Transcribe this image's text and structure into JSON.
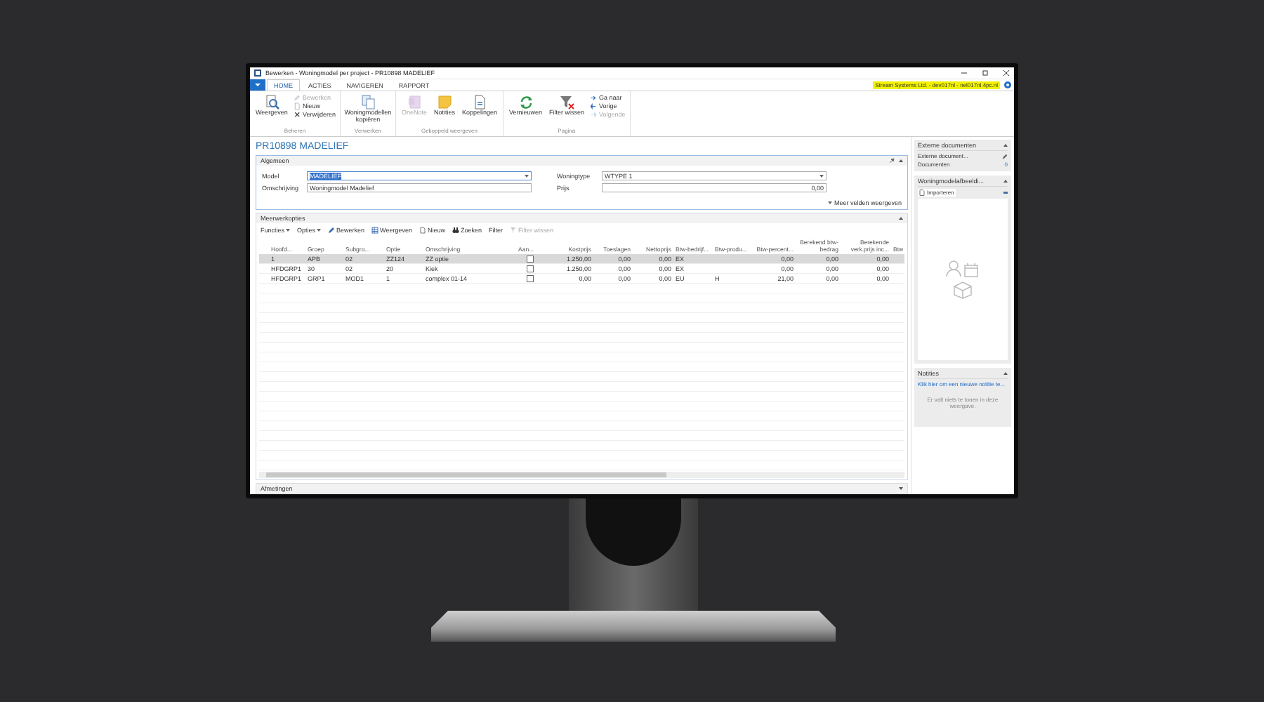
{
  "window": {
    "title": "Bewerken - Woningmodel per project - PR10898 MADELIEF"
  },
  "tabs": [
    {
      "label": "HOME",
      "selected": true
    },
    {
      "label": "ACTIES",
      "selected": false
    },
    {
      "label": "NAVIGEREN",
      "selected": false
    },
    {
      "label": "RAPPORT",
      "selected": false
    }
  ],
  "company": "Stream Systems Ltd. - dev017nl - nel017nl.4pc.nl",
  "ribbon": [
    {
      "label": "Beheren",
      "items": [
        {
          "label": "Weergeven",
          "kind": "large",
          "disabled": false
        },
        {
          "label": "Bewerken",
          "kind": "small",
          "disabled": true
        },
        {
          "label": "Nieuw",
          "kind": "small",
          "disabled": false
        },
        {
          "label": "Verwijderen",
          "kind": "small",
          "disabled": false
        }
      ]
    },
    {
      "label": "Verwerken",
      "items": [
        {
          "label": "Woningmodellen kopiëren",
          "kind": "large",
          "disabled": false
        }
      ]
    },
    {
      "label": "Gekoppeld weergeven",
      "items": [
        {
          "label": "OneNote",
          "kind": "large",
          "disabled": true
        },
        {
          "label": "Notities",
          "kind": "large",
          "disabled": false
        },
        {
          "label": "Koppelingen",
          "kind": "large",
          "disabled": false
        }
      ]
    },
    {
      "label": "Pagina",
      "items": [
        {
          "label": "Vernieuwen",
          "kind": "large",
          "disabled": false
        },
        {
          "label": "Filter wissen",
          "kind": "large",
          "disabled": false
        },
        {
          "label": "Ga naar",
          "kind": "small",
          "disabled": false
        },
        {
          "label": "Vorige",
          "kind": "small",
          "disabled": false
        },
        {
          "label": "Volgende",
          "kind": "small",
          "disabled": true
        }
      ]
    }
  ],
  "page_title": "PR10898 MADELIEF",
  "general": {
    "title": "Algemeen",
    "fields": [
      {
        "label": "Model",
        "value": "MADELIEF",
        "kind": "dropdown",
        "focused": true
      },
      {
        "label": "Omschrijving",
        "value": "Woningmodel Madelief",
        "kind": "text",
        "focused": false
      },
      {
        "label": "Woningtype",
        "value": "WTYPE 1",
        "kind": "dropdown",
        "focused": false
      },
      {
        "label": "Prijs",
        "value": "0,00",
        "kind": "number",
        "focused": false
      }
    ],
    "more_fields": "Meer velden weergeven"
  },
  "lines": {
    "title": "Meerwerkopties",
    "toolbar": [
      {
        "label": "Functies",
        "kind": "menu",
        "disabled": false
      },
      {
        "label": "Opties",
        "kind": "menu",
        "disabled": false
      },
      {
        "label": "Bewerken",
        "kind": "icon",
        "disabled": false
      },
      {
        "label": "Weergeven",
        "kind": "icon",
        "disabled": false
      },
      {
        "label": "Nieuw",
        "kind": "icon",
        "disabled": false
      },
      {
        "label": "Zoeken",
        "kind": "icon",
        "disabled": false
      },
      {
        "label": "Filter",
        "kind": "text",
        "disabled": false
      },
      {
        "label": "Filter wissen",
        "kind": "icon",
        "disabled": true
      }
    ],
    "columns": [
      {
        "label": "Hoofd...",
        "kind": "text"
      },
      {
        "label": "Groep",
        "kind": "text"
      },
      {
        "label": "Subgro...",
        "kind": "text"
      },
      {
        "label": "Optie",
        "kind": "text"
      },
      {
        "label": "Omschrijving",
        "kind": "text"
      },
      {
        "label": "Aan...",
        "kind": "checkbox"
      },
      {
        "label": "Kostprijs",
        "kind": "number"
      },
      {
        "label": "Toeslagen",
        "kind": "number"
      },
      {
        "label": "Nettoprijs",
        "kind": "number"
      },
      {
        "label": "Btw-bedrijf...",
        "kind": "text"
      },
      {
        "label": "Btw-produ...",
        "kind": "text"
      },
      {
        "label": "Btw-percent...",
        "kind": "number"
      },
      {
        "label": "Berekend btw-bedrag",
        "kind": "number"
      },
      {
        "label": "Berekende verk.prijs inc...",
        "kind": "number"
      },
      {
        "label": "Btw",
        "kind": "text"
      }
    ],
    "rows": [
      {
        "selected": true,
        "checked": false,
        "cells": [
          "1",
          "APB",
          "02",
          "ZZ124",
          "ZZ optie",
          null,
          "1.250,00",
          "0,00",
          "0,00",
          "EX",
          null,
          "0,00",
          "0,00",
          "0,00",
          null
        ]
      },
      {
        "selected": false,
        "checked": false,
        "cells": [
          "HFDGRP1",
          "30",
          "02",
          "20",
          "Kiek",
          null,
          "1.250,00",
          "0,00",
          "0,00",
          "EX",
          null,
          "0,00",
          "0,00",
          "0,00",
          null
        ]
      },
      {
        "selected": false,
        "checked": false,
        "cells": [
          "HFDGRP1",
          "GRP1",
          "MOD1",
          "1",
          "complex 01-14",
          null,
          "0,00",
          "0,00",
          "0,00",
          "EU",
          "H",
          "21,00",
          "0,00",
          "0,00",
          null
        ]
      }
    ]
  },
  "collapsed_panel": {
    "title": "Afmetingen"
  },
  "factboxes": [
    {
      "title": "Externe documenten",
      "kind": "documents",
      "lines": [
        {
          "label": "Externe document..."
        },
        {
          "label": "Documenten",
          "count": "0"
        }
      ]
    },
    {
      "title": "Woningmodelafbeeldi...",
      "kind": "image",
      "action": "Importeren"
    },
    {
      "title": "Notities",
      "kind": "notes",
      "link": "Klik hier om een nieuwe notitie te...",
      "empty_text": "Er valt niets te tonen in deze weergave."
    }
  ]
}
